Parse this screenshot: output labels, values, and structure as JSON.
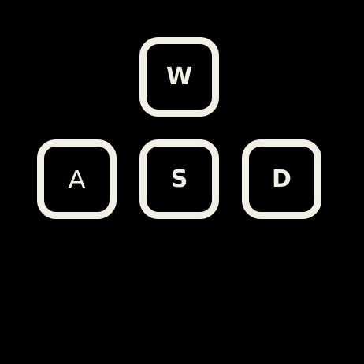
{
  "keys": {
    "w": {
      "label": "W"
    },
    "a": {
      "label": "A"
    },
    "s": {
      "label": "S"
    },
    "d": {
      "label": "D"
    }
  },
  "colors": {
    "background": "#000000",
    "key_outline": "#f2f0e6",
    "key_text": "#f2f0e6"
  }
}
